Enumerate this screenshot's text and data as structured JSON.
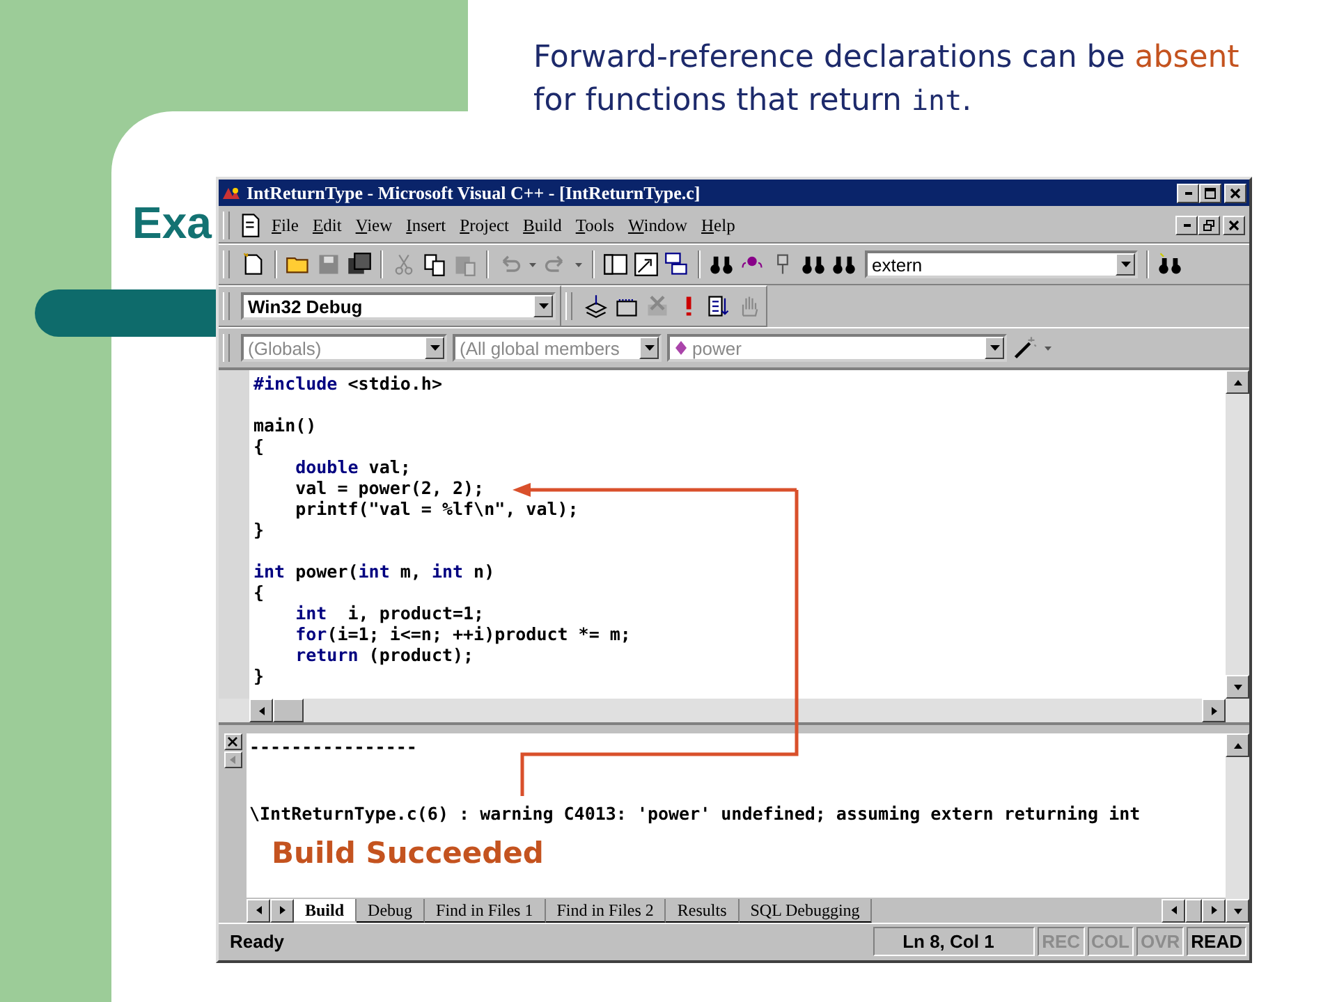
{
  "slide": {
    "title": "Exa",
    "caption": [
      {
        "text": "Forward-reference declarations can be ",
        "kind": "plain"
      },
      {
        "text": "absent",
        "kind": "emphasis"
      },
      {
        "text": " for functions that return ",
        "kind": "plain"
      },
      {
        "text": "int",
        "kind": "code"
      },
      {
        "text": ".",
        "kind": "plain"
      }
    ],
    "note": "Build Succeeded"
  },
  "window": {
    "title": "IntReturnType - Microsoft Visual C++ - [IntReturnType.c]"
  },
  "menu": [
    "File",
    "Edit",
    "View",
    "Insert",
    "Project",
    "Build",
    "Tools",
    "Window",
    "Help"
  ],
  "find_combo": {
    "value": "extern"
  },
  "config_combo": {
    "value": "Win32 Debug"
  },
  "wizard_bar": [
    {
      "value": "(Globals)"
    },
    {
      "value": "(All global members"
    },
    {
      "value": "power",
      "kind": "member"
    }
  ],
  "editor": {
    "lines": [
      {
        "kind": "code",
        "segments": [
          {
            "text": "#include",
            "kind": "keyword"
          },
          {
            "text": " <stdio.h>",
            "kind": "plain"
          }
        ]
      },
      {
        "kind": "blank"
      },
      {
        "kind": "code",
        "segments": [
          {
            "text": "main()",
            "kind": "plain"
          }
        ]
      },
      {
        "kind": "code",
        "segments": [
          {
            "text": "{",
            "kind": "plain"
          }
        ]
      },
      {
        "kind": "code",
        "segments": [
          {
            "text": "    double",
            "kind": "keyword"
          },
          {
            "text": " val;",
            "kind": "plain"
          }
        ]
      },
      {
        "kind": "code",
        "segments": [
          {
            "text": "    val = power(2, 2);",
            "kind": "plain"
          }
        ]
      },
      {
        "kind": "code",
        "segments": [
          {
            "text": "    printf(\"val = %lf\\n\", val);",
            "kind": "plain"
          }
        ]
      },
      {
        "kind": "code",
        "segments": [
          {
            "text": "}",
            "kind": "plain"
          }
        ]
      },
      {
        "kind": "blank"
      },
      {
        "kind": "code",
        "segments": [
          {
            "text": "int",
            "kind": "keyword"
          },
          {
            "text": " power(",
            "kind": "plain"
          },
          {
            "text": "int",
            "kind": "keyword"
          },
          {
            "text": " m, ",
            "kind": "plain"
          },
          {
            "text": "int",
            "kind": "keyword"
          },
          {
            "text": " n)",
            "kind": "plain"
          }
        ]
      },
      {
        "kind": "code",
        "segments": [
          {
            "text": "{",
            "kind": "plain"
          }
        ]
      },
      {
        "kind": "code",
        "segments": [
          {
            "text": "    int",
            "kind": "keyword"
          },
          {
            "text": "  i, product=1;",
            "kind": "plain"
          }
        ]
      },
      {
        "kind": "code",
        "segments": [
          {
            "text": "    for",
            "kind": "keyword"
          },
          {
            "text": "(i=1; i<=n; ++i)product *= m;",
            "kind": "plain"
          }
        ]
      },
      {
        "kind": "code",
        "segments": [
          {
            "text": "    return",
            "kind": "keyword"
          },
          {
            "text": " (product);",
            "kind": "plain"
          }
        ]
      },
      {
        "kind": "code",
        "segments": [
          {
            "text": "}",
            "kind": "plain"
          }
        ]
      }
    ]
  },
  "output": {
    "separator": "----------------",
    "warning": "\\IntReturnType.c(6) : warning C4013: 'power' undefined; assuming extern returning int"
  },
  "output_tabs": [
    {
      "label": "Build",
      "selected": true
    },
    {
      "label": "Debug",
      "selected": false
    },
    {
      "label": "Find in Files 1",
      "selected": false
    },
    {
      "label": "Find in Files 2",
      "selected": false
    },
    {
      "label": "Results",
      "selected": false
    },
    {
      "label": "SQL Debugging",
      "selected": false
    }
  ],
  "status_bar": {
    "message": "Ready",
    "position": "Ln 8, Col 1",
    "indicators": [
      {
        "label": "REC",
        "disabled": true
      },
      {
        "label": "COL",
        "disabled": true
      },
      {
        "label": "OVR",
        "disabled": true
      },
      {
        "label": "READ",
        "disabled": false
      }
    ]
  }
}
